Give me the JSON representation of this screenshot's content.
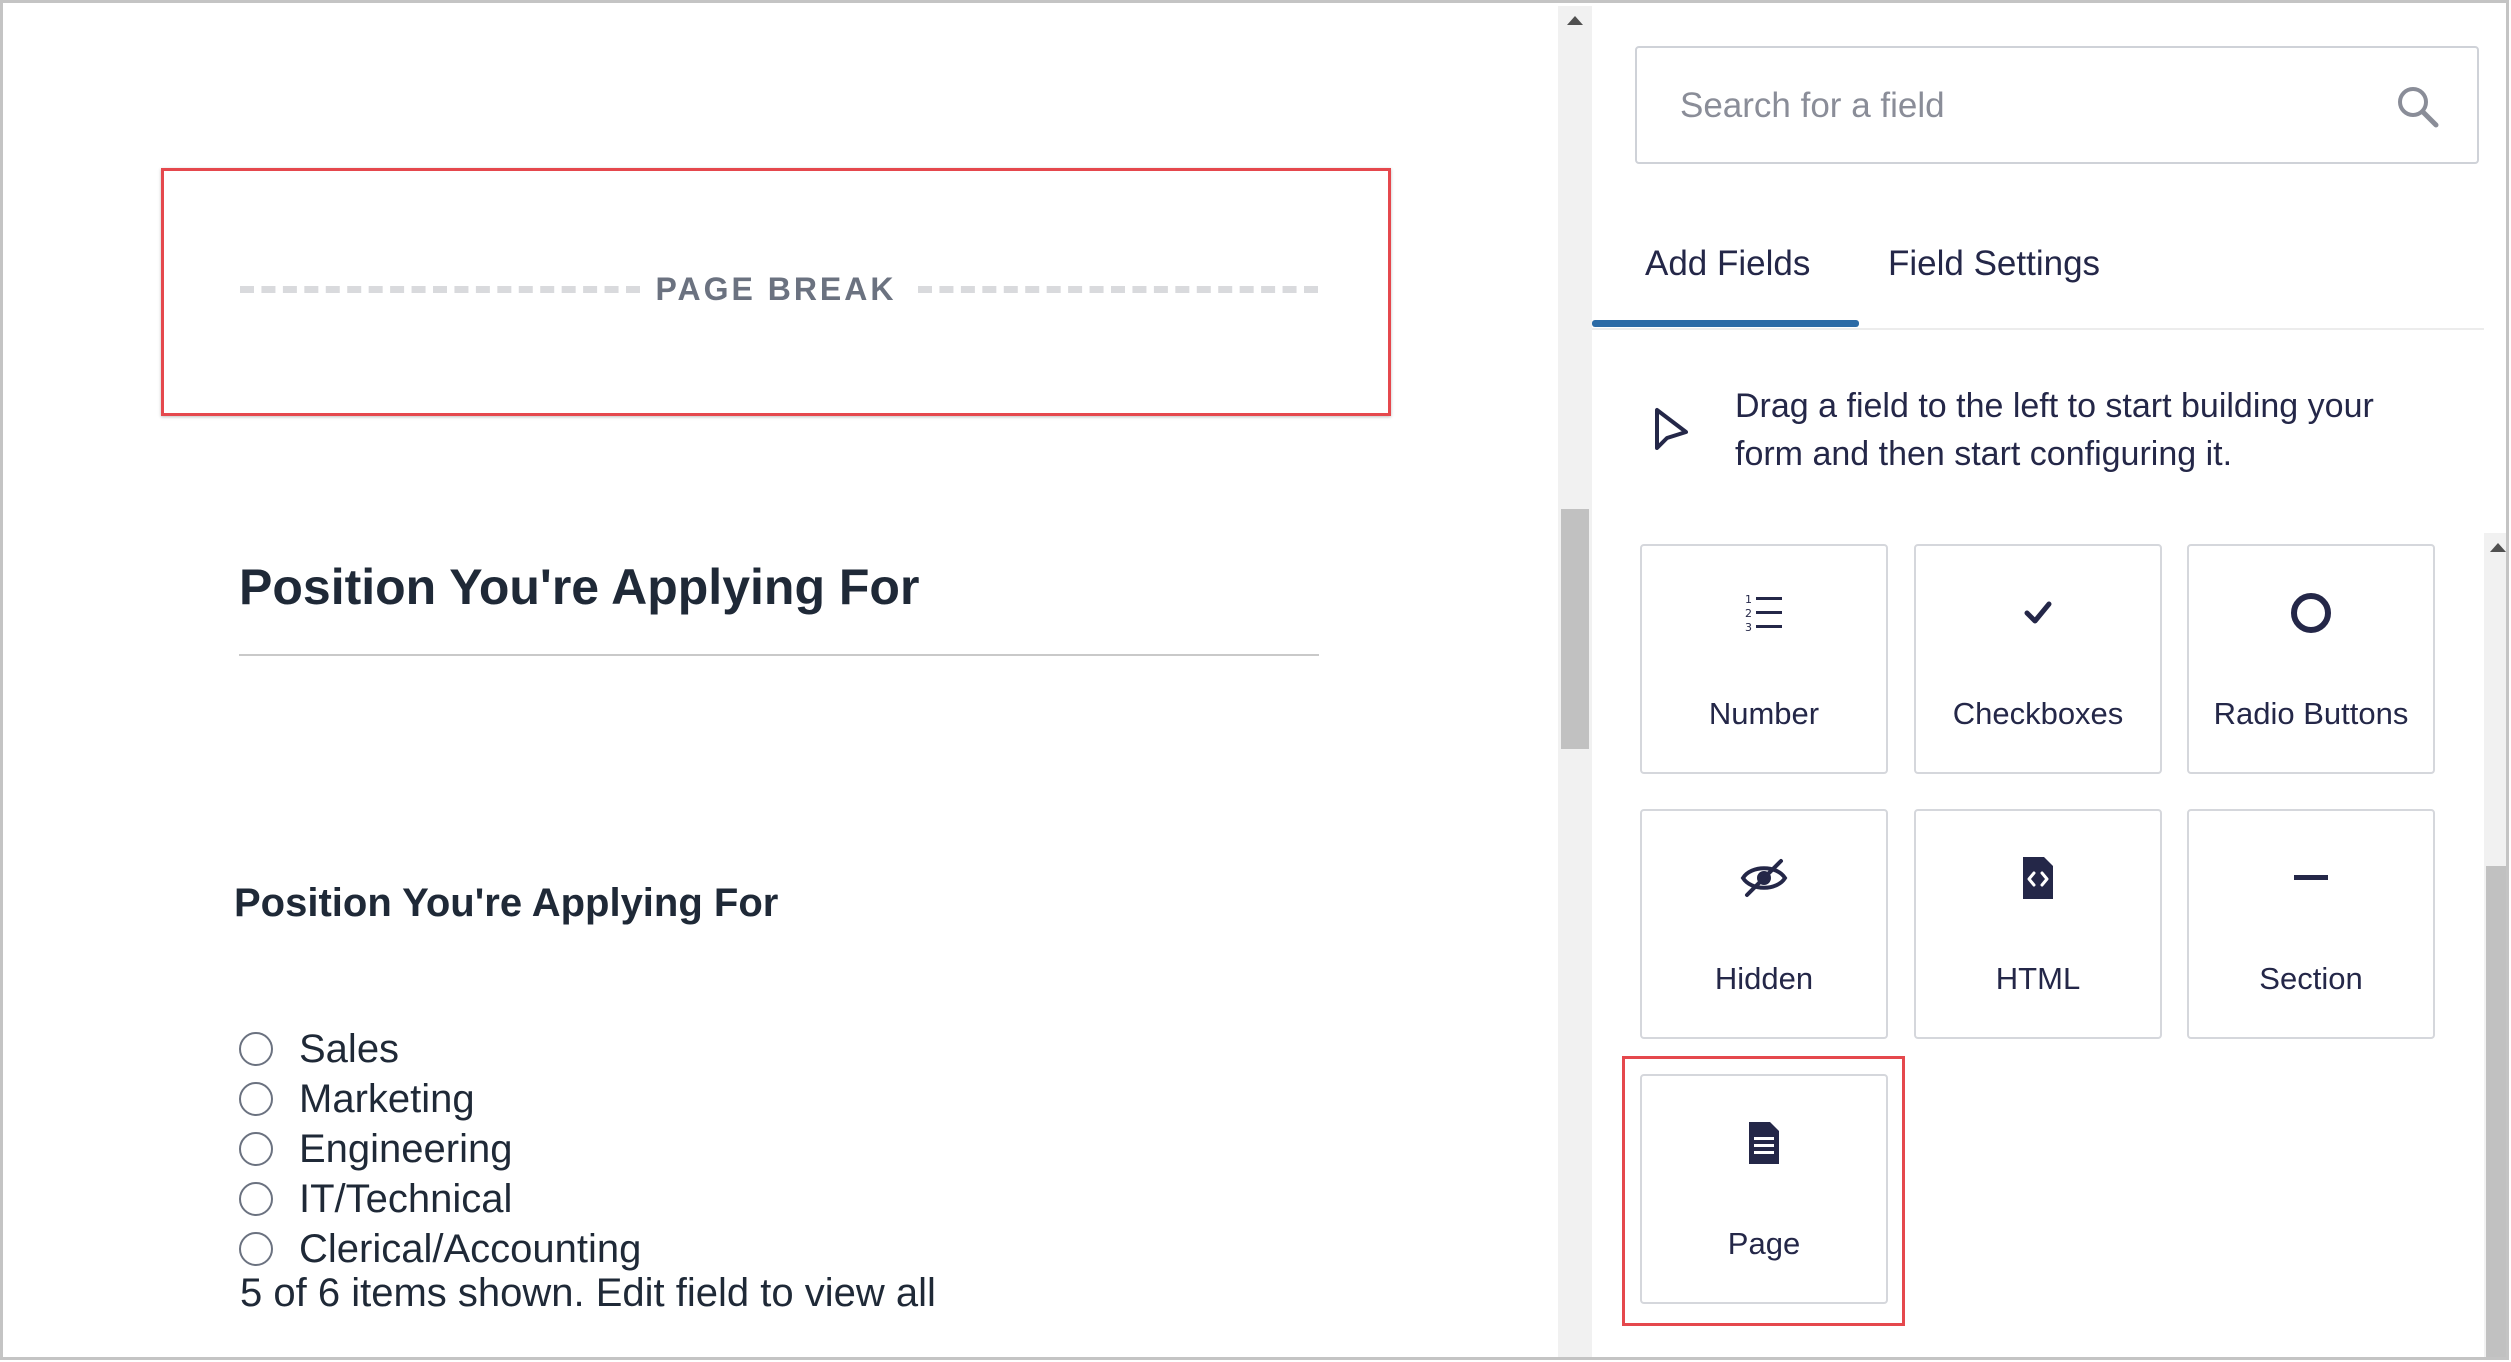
{
  "canvas": {
    "page_break_label": "PAGE BREAK",
    "section_title": "Position You're Applying For",
    "field_label": "Position You're Applying For",
    "choices": [
      "Sales",
      "Marketing",
      "Engineering",
      "IT/Technical",
      "Clerical/Accounting"
    ],
    "items_note": "5 of 6 items shown. Edit field to view all"
  },
  "sidebar": {
    "search_placeholder": "Search for a field",
    "tabs": [
      {
        "label": "Add Fields",
        "active": true
      },
      {
        "label": "Field Settings",
        "active": false
      }
    ],
    "hint": "Drag a field to the left to start building your form and then start configuring it.",
    "tiles": [
      {
        "label": "Number",
        "icon": "numbered-list-icon"
      },
      {
        "label": "Checkboxes",
        "icon": "checkmark-icon"
      },
      {
        "label": "Radio Buttons",
        "icon": "radio-circle-icon"
      },
      {
        "label": "Hidden",
        "icon": "eye-slash-icon"
      },
      {
        "label": "HTML",
        "icon": "code-file-icon"
      },
      {
        "label": "Section",
        "icon": "minus-icon"
      },
      {
        "label": "Page",
        "icon": "document-icon"
      }
    ]
  },
  "colors": {
    "highlight": "#e5484d",
    "tab_accent": "#2c6ba6",
    "text": "#242748"
  }
}
